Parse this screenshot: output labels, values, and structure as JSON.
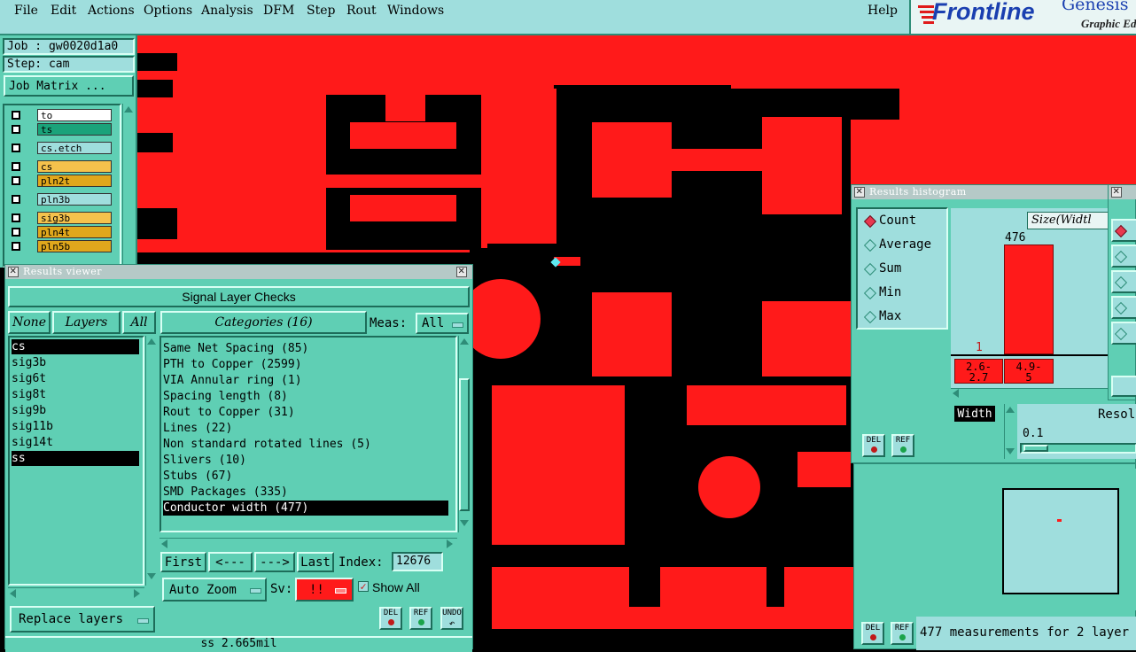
{
  "menubar": {
    "items": [
      "File",
      "Edit",
      "Actions",
      "Options",
      "Analysis",
      "DFM",
      "Step",
      "Rout",
      "Windows"
    ],
    "help": "Help",
    "brand": "Frontline",
    "product": "Genesis",
    "tagline": "Graphic Ed"
  },
  "job_panel": {
    "job": "Job : gw0020d1a0",
    "step": "Step: cam",
    "job_matrix_button": "Job Matrix ...",
    "layers": [
      {
        "name": "to",
        "color": "#ffffff"
      },
      {
        "name": "ts",
        "color": "#1aa37a"
      },
      {
        "name": "cs.etch",
        "color": "#9fdedd"
      },
      {
        "name": "cs",
        "color": "#f5c24c"
      },
      {
        "name": "pln2t",
        "color": "#e0a71c"
      },
      {
        "name": "pln3b",
        "color": "#9fdedd"
      },
      {
        "name": "sig3b",
        "color": "#f5c24c"
      },
      {
        "name": "pln4t",
        "color": "#e0a71c"
      },
      {
        "name": "pln5b",
        "color": "#e0a71c"
      }
    ]
  },
  "results_viewer": {
    "title": "Results viewer",
    "header": "Signal Layer Checks",
    "none_btn": "None",
    "layers_btn": "Layers",
    "all_btn": "All",
    "categories_btn": "Categories (16)",
    "meas_label": "Meas:",
    "meas_value": "All",
    "layers_list": [
      "cs",
      "sig3b",
      "sig6t",
      "sig8t",
      "sig9b",
      "sig11b",
      "sig14t",
      "ss"
    ],
    "layers_selected": [
      "cs",
      "ss"
    ],
    "categories": [
      "Same Net Spacing (85)",
      "PTH to Copper (2599)",
      "VIA Annular ring (1)",
      "Spacing length (8)",
      "Rout to Copper (31)",
      "Lines (22)",
      "Non standard rotated lines (5)",
      "Slivers (10)",
      "Stubs (67)",
      "SMD Packages (335)",
      "Conductor width (477)"
    ],
    "selected_category": "Conductor width (477)",
    "first_btn": "First",
    "prev_btn": "<---",
    "next_btn": "--->",
    "last_btn": "Last",
    "index_label": "Index:",
    "index_value": "12676",
    "auto_zoom": "Auto Zoom",
    "sv_label": "Sv:",
    "sv_value": "!!",
    "show_all": "Show All",
    "replace_layers": "Replace layers",
    "status": "ss 2.665mil",
    "del": "DEL",
    "ref": "REF",
    "undo": "UNDO"
  },
  "histogram": {
    "title": "Results histogram",
    "options": [
      "Count",
      "Average",
      "Sum",
      "Min",
      "Max"
    ],
    "selected": "Count",
    "size_label": "Size(Widtl",
    "bar_value": "476",
    "small_bar_value": "1",
    "bins": [
      "2.6-\n2.7",
      "4.9-\n5"
    ],
    "width_btn": "Width",
    "resol_label": "Resol",
    "resol_value": "0.1",
    "measurements": "477 measurements for 2 layer",
    "del": "DEL",
    "ref": "REF"
  },
  "colors": {
    "copper": "#ff1a1a",
    "panel": "#5fcfb4",
    "panel_light": "#9fdedd",
    "brand": "#1a3fb0",
    "brand_accent": "#e01a1a"
  }
}
